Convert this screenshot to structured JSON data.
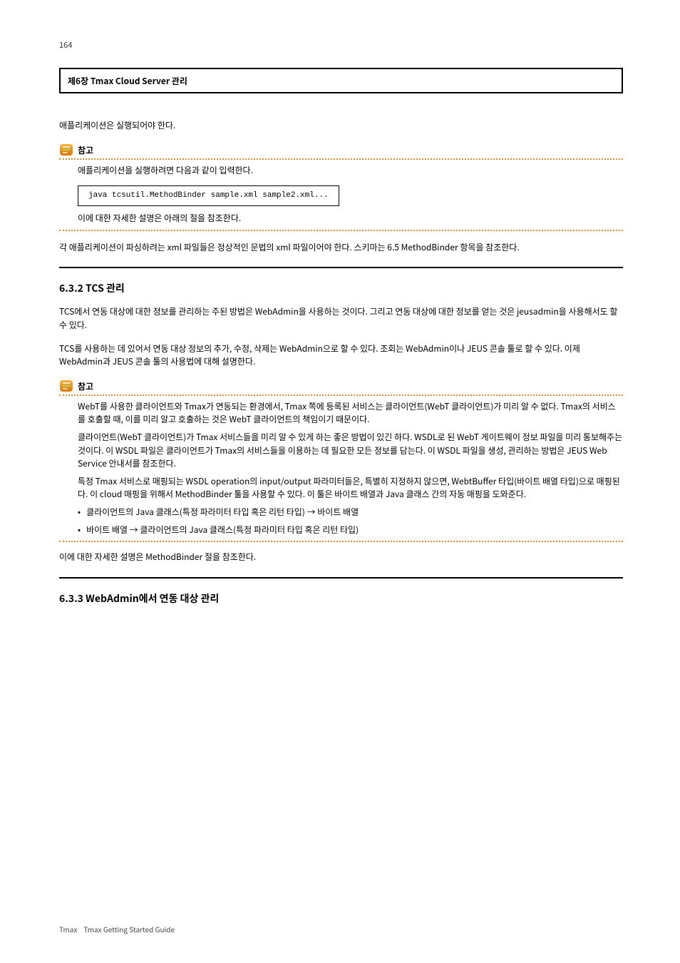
{
  "page_number": "164",
  "chapter_title": "제6장 Tmax Cloud Server 관리",
  "section1": {
    "intro": "애플리케이션은 실행되어야 한다.",
    "note_label": "참고",
    "note_body": "애플리케이션을 실행하려면 다음과 같이 입력한다.",
    "code": "java tcsutil.MethodBinder sample.xml sample2.xml...",
    "note_tail": "이에 대한 자세한 설명은 아래의 절을 참조한다."
  },
  "divider_followup": "각 애플리케이션이 파싱하려는 xml 파일들은 정상적인 문법의 xml 파일이어야 한다. 스키마는 6.5 MethodBinder 항목을 참조한다.",
  "section2": {
    "heading": "6.3.2  TCS 관리",
    "para1": "TCS에서 연동 대상에 대한 정보를 관리하는 주된 방법은 WebAdmin을 사용하는 것이다. 그리고 연동 대상에 대한 정보를 얻는 것은 jeusadmin을 사용해서도 할 수 있다.",
    "para2": "TCS를 사용하는 데 있어서 연동 대상 정보의 추가, 수정, 삭제는 WebAdmin으로 할 수 있다. 조회는 WebAdmin이나 JEUS 콘솔 툴로 할 수 있다. 이제 WebAdmin과 JEUS 콘솔 툴의 사용법에 대해 설명한다.",
    "note_label": "참고",
    "note_body_1": "WebT를 사용한 클라이언트와 Tmax가 연동되는 환경에서, Tmax 쪽에 등록된 서비스는 클라이언트(WebT 클라이언트)가 미리 알 수 없다. Tmax의 서비스를 호출할 때, 이를 미리 알고 호출하는 것은 WebT 클라이언트의 책임이기 때문이다.",
    "note_body_2": "클라이언트(WebT 클라이언트)가 Tmax 서비스들을 미리 알 수 있게 하는 좋은 방법이 있긴 하다. WSDL로 된 WebT 게이트웨이 정보 파일을 미리 통보해주는 것이다. 이 WSDL 파일은 클라이언트가 Tmax의 서비스들을 이용하는 데 필요한 모든 정보를 담는다. 이 WSDL 파일을 생성, 관리하는 방법은 JEUS Web Service 안내서를 참조한다.",
    "note_body_3": "특정 Tmax 서비스로 매핑되는 WSDL operation의 input/output 파라미터들은, 특별히 지정하지 않으면, WebtBuffer 타입(바이트 배열 타입)으로 매핑된다. 이 cloud 매핑을 위해서 MethodBinder 툴을 사용할 수 있다. 이 툴은 바이트 배열과 Java 클래스 간의 자동 매핑을 도와준다.",
    "bullet1": "클라이언트의 Java 클래스(특정 파라미터 타입 혹은 리턴 타입) → 바이트 배열",
    "bullet2": "바이트 배열 → 클라이언트의 Java 클래스(특정 파라미터 타입 혹은 리턴 타입)"
  },
  "after_note": "이에 대한 자세한 설명은 MethodBinder 절을 참조한다.",
  "section3": {
    "heading": "6.3.3  WebAdmin에서 연동 대상 관리"
  },
  "footer": {
    "product": "Tmax",
    "doc": "Tmax Getting Started Guide"
  }
}
